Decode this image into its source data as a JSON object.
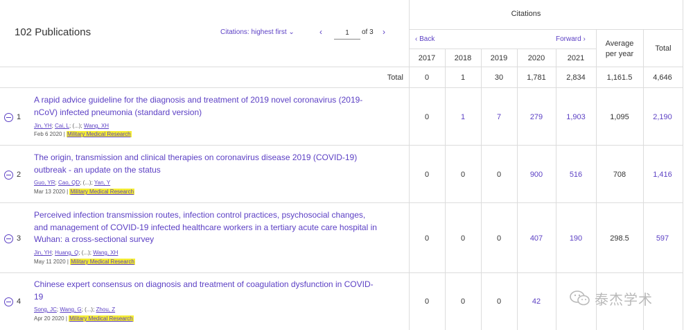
{
  "header": {
    "publication_count": "102 Publications",
    "sort_label": "Citations: highest first",
    "page_current": "1",
    "page_of": "of 3",
    "prev_icon": "chevron-left-icon",
    "next_icon": "chevron-right-icon"
  },
  "citations": {
    "title": "Citations",
    "back_label": "Back",
    "forward_label": "Forward",
    "years": [
      "2017",
      "2018",
      "2019",
      "2020",
      "2021"
    ],
    "average_label_line1": "Average",
    "average_label_line2": "per year",
    "total_label": "Total"
  },
  "totals": {
    "label": "Total",
    "values": [
      "0",
      "1",
      "30",
      "1,781",
      "2,834"
    ],
    "average": "1,161.5",
    "total": "4,646"
  },
  "rows": [
    {
      "num": "1",
      "title_line1": "A rapid advice guideline for the diagnosis and treatment of 2019 novel coronavirus (2019-",
      "title_line2": "nCoV) infected pneumonia (standard version)",
      "title_line3": "",
      "authors": [
        "Jin, YH",
        "Cai, L",
        "Wang, XH"
      ],
      "date": "Feb 6 2020",
      "journal": "Military Medical Research",
      "values": [
        "0",
        "1",
        "7",
        "279",
        "1,903"
      ],
      "average": "1,095",
      "total": "2,190"
    },
    {
      "num": "2",
      "title_line1": "The origin, transmission and clinical therapies on coronavirus disease 2019 (COVID-19)",
      "title_line2": "outbreak - an update on the status",
      "title_line3": "",
      "authors": [
        "Guo, YR",
        "Cao, QD",
        "Yan, Y"
      ],
      "date": "Mar 13 2020",
      "journal": "Military Medical Research",
      "values": [
        "0",
        "0",
        "0",
        "900",
        "516"
      ],
      "average": "708",
      "total": "1,416"
    },
    {
      "num": "3",
      "title_line1": "Perceived infection transmission routes, infection control practices, psychosocial changes,",
      "title_line2": "and management of COVID-19 infected healthcare workers in a tertiary acute care hospital in",
      "title_line3": "Wuhan: a cross-sectional survey",
      "authors": [
        "Jin, YH",
        "Huang, Q",
        "Wang, XH"
      ],
      "date": "May 11 2020",
      "journal": "Military Medical Research",
      "values": [
        "0",
        "0",
        "0",
        "407",
        "190"
      ],
      "average": "298.5",
      "total": "597"
    },
    {
      "num": "4",
      "title_line1": "Chinese expert consensus on diagnosis and treatment of coagulation dysfunction in COVID-",
      "title_line2": "19",
      "title_line3": "",
      "authors": [
        "Song, JC",
        "Wang, G",
        "Zhou, Z"
      ],
      "date": "Apr 20 2020",
      "journal": "Military Medical Research",
      "values": [
        "0",
        "0",
        "0",
        "42",
        ""
      ],
      "average": "",
      "total": ""
    }
  ],
  "author_ellipsis": "(...)",
  "watermark": "泰杰学术",
  "colors": {
    "accent": "#5b3fc4",
    "highlight": "#f5ee32",
    "grid": "#dcdcdc"
  }
}
